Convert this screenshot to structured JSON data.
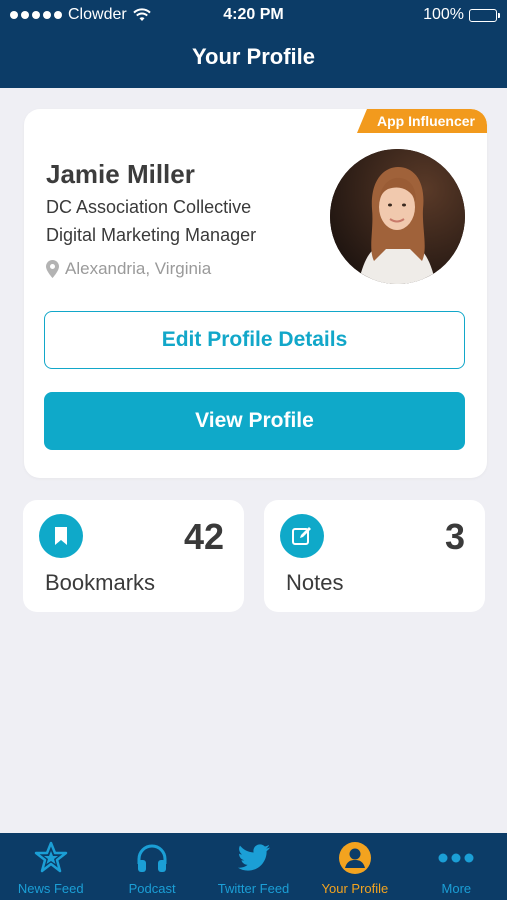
{
  "status_bar": {
    "carrier": "Clowder",
    "time": "4:20 PM",
    "battery": "100%"
  },
  "header": {
    "title": "Your Profile"
  },
  "profile": {
    "badge": "App Influencer",
    "name": "Jamie Miller",
    "organization": "DC Association Collective",
    "role": "Digital Marketing Manager",
    "location": "Alexandria, Virginia",
    "edit_button": "Edit Profile Details",
    "view_button": "View Profile"
  },
  "stats": [
    {
      "label": "Bookmarks",
      "count": "42",
      "icon": "bookmark-icon"
    },
    {
      "label": "Notes",
      "count": "3",
      "icon": "edit-note-icon"
    }
  ],
  "tabs": [
    {
      "label": "News Feed",
      "icon": "star-icon",
      "active": false
    },
    {
      "label": "Podcast",
      "icon": "headphones-icon",
      "active": false
    },
    {
      "label": "Twitter Feed",
      "icon": "twitter-bird-icon",
      "active": false
    },
    {
      "label": "Your Profile",
      "icon": "user-icon",
      "active": true
    },
    {
      "label": "More",
      "icon": "more-dots-icon",
      "active": false
    }
  ],
  "colors": {
    "header_bg": "#0c3c67",
    "accent": "#0fa9c9",
    "badge": "#f29a1d",
    "tab_inactive": "#1b9fd6",
    "tab_active": "#f3a31f"
  }
}
